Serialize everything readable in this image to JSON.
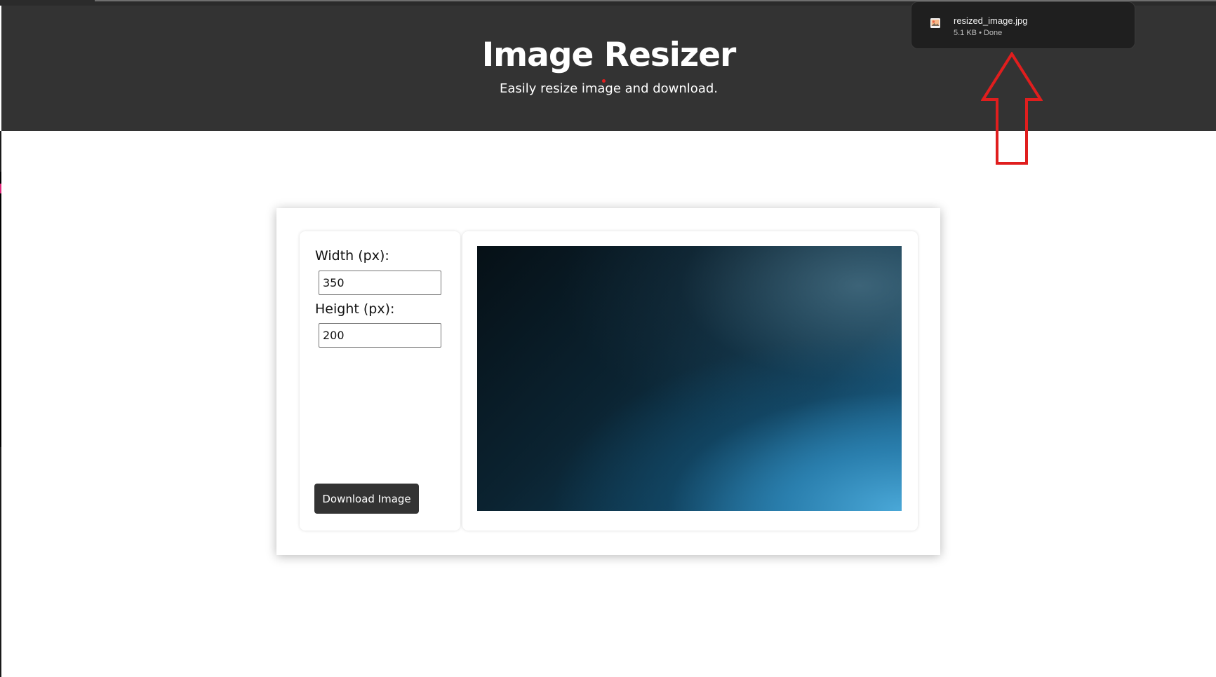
{
  "header": {
    "title": "Image Resizer",
    "subtitle": "Easily resize image and download."
  },
  "download_popup": {
    "file_name": "resized_image.jpg",
    "status": "5.1 KB • Done",
    "file_icon": "image-file-icon"
  },
  "annotation": {
    "arrow_icon": "up-arrow-outline-icon",
    "arrow_color": "#e01e1e"
  },
  "controls": {
    "width_label": "Width (px):",
    "width_value": "350",
    "height_label": "Height (px):",
    "height_value": "200",
    "download_label": "Download Image"
  },
  "colors": {
    "header_bg": "#333333",
    "button_bg": "#333333",
    "popup_bg": "#1f1f1f"
  }
}
